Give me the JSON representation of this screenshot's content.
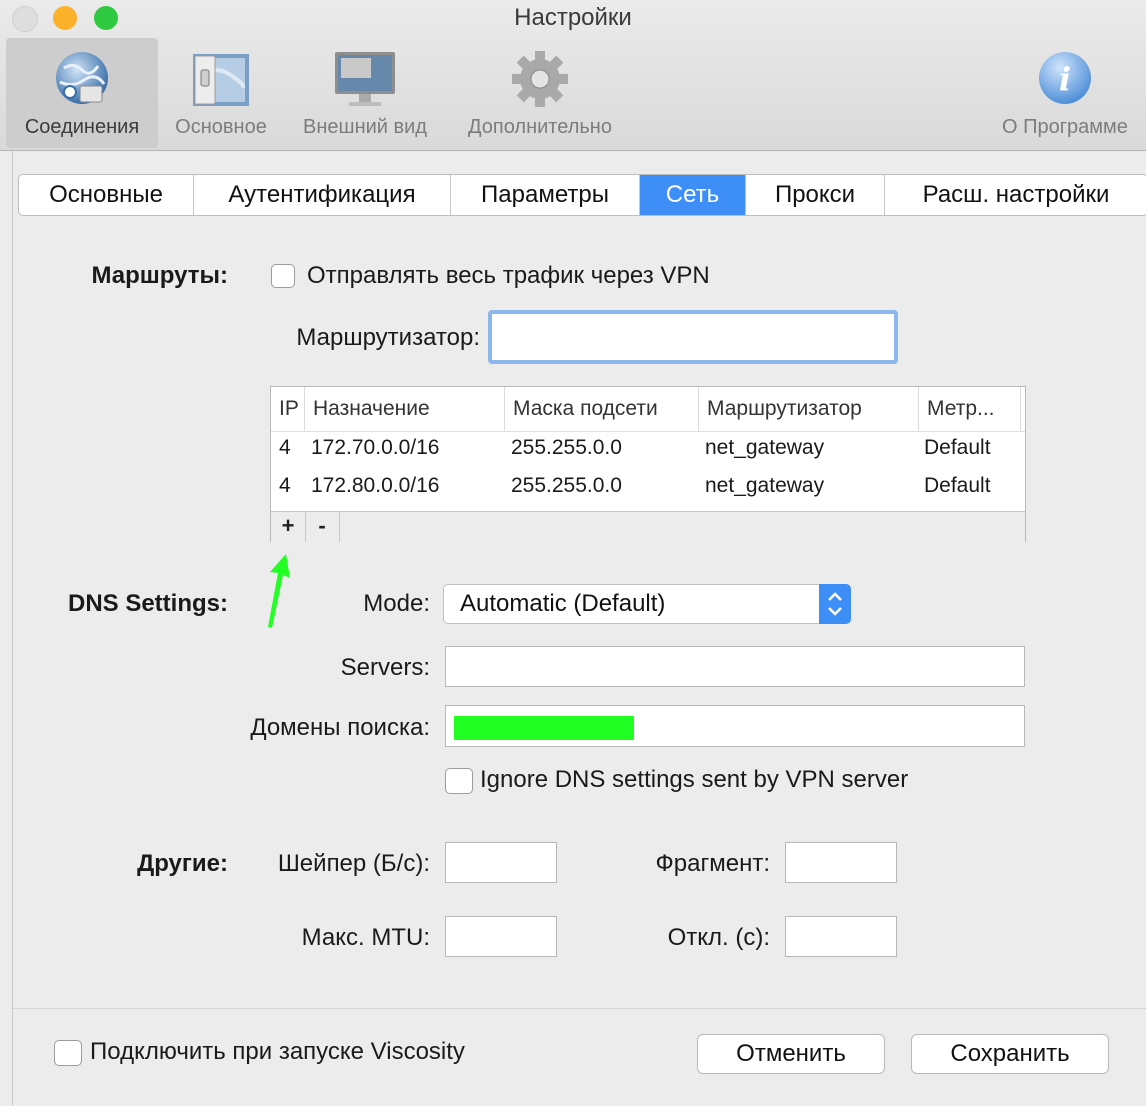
{
  "window": {
    "title": "Настройки",
    "traffic_colors": [
      "#dedede",
      "#fcb12b",
      "#2fc93f"
    ]
  },
  "toolbar": {
    "items": [
      {
        "label": "Соединения",
        "icon": "globe-network-icon"
      },
      {
        "label": "Основное",
        "icon": "switch-panel-icon"
      },
      {
        "label": "Внешний вид",
        "icon": "display-monitor-icon"
      },
      {
        "label": "Дополнительно",
        "icon": "gear-icon"
      },
      {
        "label": "О Программе",
        "icon": "info-icon"
      }
    ]
  },
  "tabs": [
    "Основные",
    "Аутентификация",
    "Параметры",
    "Сеть",
    "Прокси",
    "Расш. настройки"
  ],
  "active_tab": "Сеть",
  "routes": {
    "section_label": "Маршруты:",
    "send_all_label": "Отправлять весь трафик через VPN",
    "send_all_checked": false,
    "gateway_label": "Маршрутизатор:",
    "gateway_value": "",
    "table": {
      "headers": [
        "IP",
        "Назначение",
        "Маска подсети",
        "Маршрутизатор",
        "Метр..."
      ],
      "rows": [
        [
          "4",
          "172.70.0.0/16",
          "255.255.0.0",
          "net_gateway",
          "Default"
        ],
        [
          "4",
          "172.80.0.0/16",
          "255.255.0.0",
          "net_gateway",
          "Default"
        ]
      ]
    },
    "add_label": "+",
    "remove_label": "-"
  },
  "dns": {
    "section_label": "DNS Settings:",
    "mode_label": "Mode:",
    "mode_value": "Automatic (Default)",
    "servers_label": "Servers:",
    "servers_value": "",
    "domains_label": "Домены поиска:",
    "domains_value": "",
    "ignore_label": "Ignore DNS settings sent by VPN server",
    "ignore_checked": false
  },
  "other": {
    "section_label": "Другие:",
    "shaper_label": "Шейпер (Б/с):",
    "fragment_label": "Фрагмент:",
    "mtu_label": "Макс. MTU:",
    "timeout_label": "Откл. (с):"
  },
  "footer": {
    "autoconnect_label": "Подключить при запуске Viscosity",
    "cancel_label": "Отменить",
    "save_label": "Сохранить"
  },
  "colors": {
    "accent": "#3d8ff7",
    "highlight_green": "#22ff22"
  }
}
